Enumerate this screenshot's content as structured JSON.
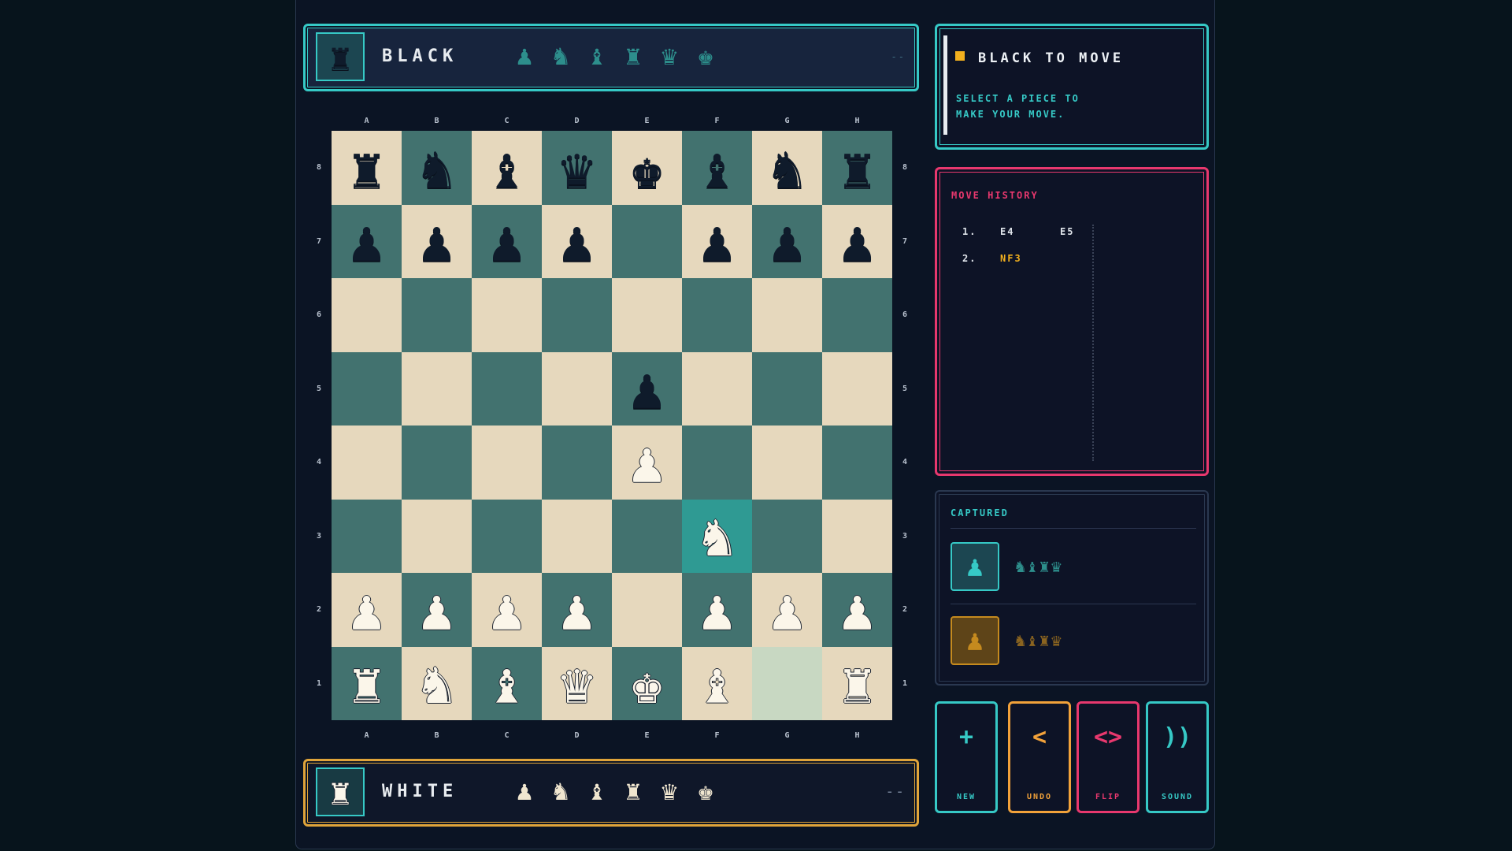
{
  "players": {
    "black": {
      "name": "BLACK",
      "avatar_icon": "♜",
      "pieces": [
        "♟",
        "♞",
        "♝",
        "♜",
        "♛",
        "♚"
      ],
      "timer": "--"
    },
    "white": {
      "name": "WHITE",
      "avatar_icon": "♜",
      "pieces": [
        "♟",
        "♞",
        "♝",
        "♜",
        "♛",
        "♚"
      ],
      "timer": "--"
    }
  },
  "board": {
    "files": [
      "A",
      "B",
      "C",
      "D",
      "E",
      "F",
      "G",
      "H"
    ],
    "ranks": [
      "8",
      "7",
      "6",
      "5",
      "4",
      "3",
      "2",
      "1"
    ],
    "squares": [
      [
        "r",
        "n",
        "b",
        "q",
        "k",
        "b",
        "n",
        "r"
      ],
      [
        "p",
        "p",
        "p",
        "p",
        "",
        "p",
        "p",
        "p"
      ],
      [
        "",
        "",
        "",
        "",
        "",
        "",
        "",
        ""
      ],
      [
        "",
        "",
        "",
        "",
        "p",
        "",
        "",
        ""
      ],
      [
        "",
        "",
        "",
        "",
        "P",
        "",
        "",
        ""
      ],
      [
        "",
        "",
        "",
        "",
        "",
        "N",
        "",
        ""
      ],
      [
        "P",
        "P",
        "P",
        "P",
        "",
        "P",
        "P",
        "P"
      ],
      [
        "R",
        "N",
        "B",
        "Q",
        "K",
        "B",
        "",
        "R"
      ]
    ],
    "last_move_to": "f3",
    "last_move_from": "g1",
    "colors": {
      "light": "#e6d8bd",
      "dark": "#42726f",
      "highlight_to": "#2f9a93",
      "highlight_from": "#c8d8c2"
    }
  },
  "status": {
    "title": "BLACK TO MOVE",
    "subtitle_line1": "SELECT A PIECE TO",
    "subtitle_line2": "MAKE YOUR MOVE."
  },
  "history": {
    "title": "MOVE HISTORY",
    "moves": [
      {
        "n": "1.",
        "w": "E4",
        "b": "E5"
      },
      {
        "n": "2.",
        "w": "NF3",
        "b": ""
      }
    ]
  },
  "captured": {
    "title": "CAPTURED",
    "by_white": {
      "icon": "♟",
      "pieces": "♞♝♜♛"
    },
    "by_black": {
      "icon": "♟",
      "pieces": "♞♝♜♛"
    }
  },
  "buttons": {
    "new": {
      "label": "NEW",
      "icon": "+",
      "color": "#36c9c6"
    },
    "undo": {
      "label": "UNDO",
      "icon": "<",
      "color": "#f2a23a"
    },
    "flip": {
      "label": "FLIP",
      "icon": "<>",
      "color": "#e8386e"
    },
    "sound": {
      "label": "SOUND",
      "icon": "))",
      "color": "#36c9c6"
    }
  }
}
